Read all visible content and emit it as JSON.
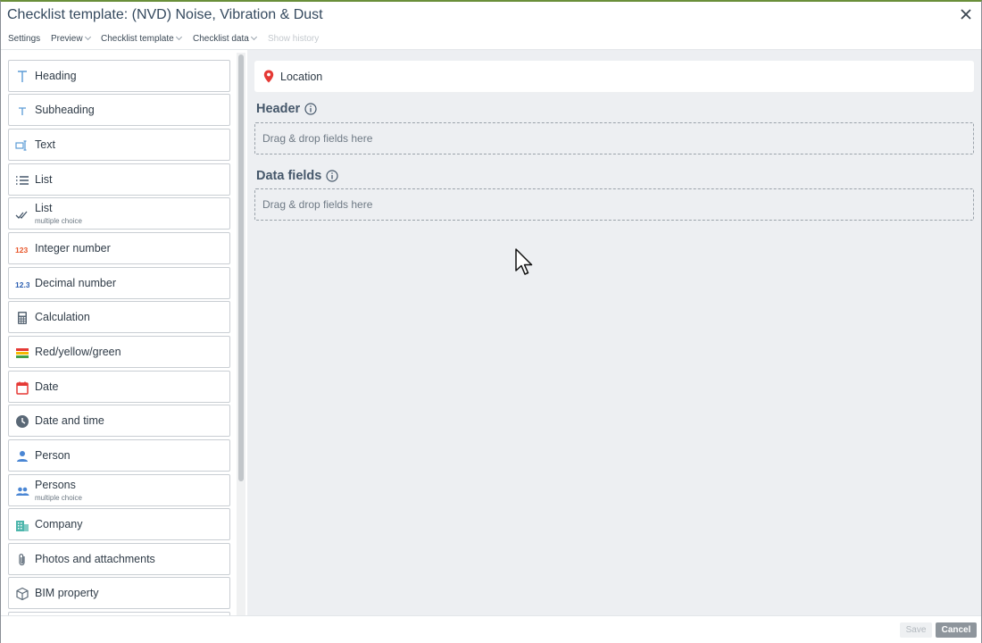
{
  "window": {
    "title": "Checklist template: (NVD) Noise, Vibration & Dust"
  },
  "menu": {
    "settings": "Settings",
    "preview": "Preview",
    "checklist_template": "Checklist template",
    "checklist_data": "Checklist data",
    "show_history": "Show history"
  },
  "fields": [
    {
      "label": "Heading",
      "icon": "heading-icon"
    },
    {
      "label": "Subheading",
      "icon": "subheading-icon"
    },
    {
      "label": "Text",
      "icon": "text-field-icon"
    },
    {
      "label": "List",
      "icon": "list-icon"
    },
    {
      "label": "List",
      "sub": "multiple choice",
      "icon": "multi-check-icon"
    },
    {
      "label": "Integer number",
      "icon": "integer-icon"
    },
    {
      "label": "Decimal number",
      "icon": "decimal-icon"
    },
    {
      "label": "Calculation",
      "icon": "calculator-icon"
    },
    {
      "label": "Red/yellow/green",
      "icon": "traffic-light-icon"
    },
    {
      "label": "Date",
      "icon": "calendar-icon"
    },
    {
      "label": "Date and time",
      "icon": "clock-icon"
    },
    {
      "label": "Person",
      "icon": "person-icon"
    },
    {
      "label": "Persons",
      "sub": "multiple choice",
      "icon": "persons-icon"
    },
    {
      "label": "Company",
      "icon": "company-icon"
    },
    {
      "label": "Photos and attachments",
      "icon": "paperclip-icon"
    },
    {
      "label": "BIM property",
      "icon": "cube-icon"
    }
  ],
  "main": {
    "location_label": "Location",
    "header_title": "Header",
    "header_dropzone": "Drag & drop fields here",
    "data_fields_title": "Data fields",
    "data_fields_dropzone": "Drag & drop fields here"
  },
  "footer": {
    "save_label": "Save",
    "cancel_label": "Cancel"
  },
  "colors": {
    "integer": "#e8562a",
    "decimal": "#2a5db0",
    "pin": "#e53935",
    "accent_blue": "#5b9bd5"
  }
}
